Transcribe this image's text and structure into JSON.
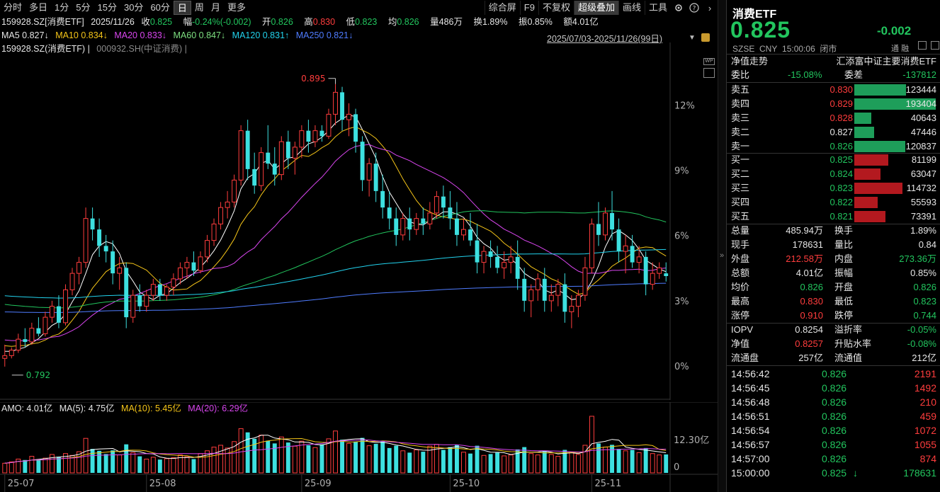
{
  "toolbar": {
    "periods": [
      "分时",
      "多日",
      "1分",
      "5分",
      "15分",
      "30分",
      "60分",
      "日",
      "周",
      "月",
      "更多"
    ],
    "active_period": "日",
    "right_items": [
      "综合屏",
      "F9",
      "不复权",
      "超级叠加",
      "画线",
      "工具"
    ],
    "highlight_item": "超级叠加",
    "icons": [
      "gear-icon",
      "help-icon",
      "chevron-right-icon"
    ]
  },
  "quote_line": {
    "code": "159928.SZ[消费ETF]",
    "date": "2025/11/26",
    "close_label": "收",
    "close": "0.825",
    "change_label": "幅",
    "change": "-0.24%(-0.002)",
    "open_label": "开",
    "open": "0.826",
    "high_label": "高",
    "high": "0.830",
    "low_label": "低",
    "low": "0.823",
    "avg_label": "均",
    "avg": "0.826",
    "vol_label": "量",
    "vol": "486万",
    "turnover_label": "换",
    "turnover": "1.89%",
    "amp_label": "振",
    "amp": "0.85%",
    "amount_label": "额",
    "amount": "4.01亿"
  },
  "ma_line": {
    "ma5": "MA5 0.827↓",
    "ma10": "MA10 0.834↓",
    "ma20": "MA20 0.833↓",
    "ma60": "MA60 0.847↓",
    "ma120": "MA120 0.831↑",
    "ma250": "MA250 0.821↓",
    "date_range": "2025/07/03-2025/11/26(99日)"
  },
  "overlay_line": {
    "main": "159928.SZ(消费ETF) |",
    "overlay": "000932.SH(中证消费) |"
  },
  "chart": {
    "high_marker": "0.895",
    "low_marker": "0.792",
    "pct_ticks": [
      "12%",
      "9%",
      "6%",
      "3%",
      "0%"
    ],
    "x_ticks": [
      "25-07",
      "25-08",
      "25-09",
      "25-10",
      "25-11"
    ]
  },
  "volume": {
    "label": "AMO: 4.01亿",
    "ma5": "MA(5): 4.75亿",
    "ma10": "MA(10): 5.45亿",
    "ma20": "MA(20): 6.29亿",
    "ticks": [
      "12.30亿",
      "0"
    ]
  },
  "panel": {
    "title": "消费ETF",
    "price": "0.825",
    "change": "-0.002",
    "exchange": "SZSE",
    "currency": "CNY",
    "time": "15:00:06",
    "status": "闭市",
    "tag1": "通",
    "tag2": "融",
    "nav_trend": "净值走势",
    "fund_name": "汇添富中证主要消费ETF",
    "wb_label": "委比",
    "wb": "-15.08%",
    "wc_label": "委差",
    "wc": "-137812",
    "asks": [
      {
        "label": "卖五",
        "price": "0.830",
        "vol": "123444",
        "color": "red"
      },
      {
        "label": "卖四",
        "price": "0.829",
        "vol": "193404",
        "color": "red"
      },
      {
        "label": "卖三",
        "price": "0.828",
        "vol": "40643",
        "color": "red"
      },
      {
        "label": "卖二",
        "price": "0.827",
        "vol": "47446",
        "color": "white"
      },
      {
        "label": "卖一",
        "price": "0.826",
        "vol": "120837",
        "color": "green"
      }
    ],
    "bids": [
      {
        "label": "买一",
        "price": "0.825",
        "vol": "81199",
        "color": "green"
      },
      {
        "label": "买二",
        "price": "0.824",
        "vol": "63047",
        "color": "green"
      },
      {
        "label": "买三",
        "price": "0.823",
        "vol": "114732",
        "color": "green"
      },
      {
        "label": "买四",
        "price": "0.822",
        "vol": "55593",
        "color": "green"
      },
      {
        "label": "买五",
        "price": "0.821",
        "vol": "73391",
        "color": "green"
      }
    ],
    "stats": [
      [
        {
          "l": "总量",
          "v": "485.94万",
          "c": "white"
        },
        {
          "l": "换手",
          "v": "1.89%",
          "c": "white"
        }
      ],
      [
        {
          "l": "现手",
          "v": "178631",
          "c": "white"
        },
        {
          "l": "量比",
          "v": "0.84",
          "c": "white"
        }
      ],
      [
        {
          "l": "外盘",
          "v": "212.58万",
          "c": "red"
        },
        {
          "l": "内盘",
          "v": "273.36万",
          "c": "green"
        }
      ],
      [
        {
          "l": "总额",
          "v": "4.01亿",
          "c": "white"
        },
        {
          "l": "振幅",
          "v": "0.85%",
          "c": "white"
        }
      ],
      [
        {
          "l": "均价",
          "v": "0.826",
          "c": "green"
        },
        {
          "l": "开盘",
          "v": "0.826",
          "c": "green"
        }
      ],
      [
        {
          "l": "最高",
          "v": "0.830",
          "c": "red"
        },
        {
          "l": "最低",
          "v": "0.823",
          "c": "green"
        }
      ],
      [
        {
          "l": "涨停",
          "v": "0.910",
          "c": "red"
        },
        {
          "l": "跌停",
          "v": "0.744",
          "c": "green"
        }
      ]
    ],
    "stats2": [
      [
        {
          "l": "IOPV",
          "v": "0.8254",
          "c": "white"
        },
        {
          "l": "溢折率",
          "v": "-0.05%",
          "c": "green"
        }
      ],
      [
        {
          "l": "净值",
          "v": "0.8257",
          "c": "red"
        },
        {
          "l": "升贴水率",
          "v": "-0.08%",
          "c": "green"
        }
      ],
      [
        {
          "l": "流通盘",
          "v": "257亿",
          "c": "white"
        },
        {
          "l": "流通值",
          "v": "212亿",
          "c": "white"
        }
      ]
    ],
    "ticks": [
      {
        "t": "14:56:42",
        "p": "0.826",
        "v": "2191"
      },
      {
        "t": "14:56:45",
        "p": "0.826",
        "v": "1492"
      },
      {
        "t": "14:56:48",
        "p": "0.826",
        "v": "210"
      },
      {
        "t": "14:56:51",
        "p": "0.826",
        "v": "459"
      },
      {
        "t": "14:56:54",
        "p": "0.826",
        "v": "1072"
      },
      {
        "t": "14:56:57",
        "p": "0.826",
        "v": "1055"
      },
      {
        "t": "14:57:00",
        "p": "0.826",
        "v": "874"
      },
      {
        "t": "15:00:00",
        "p": "0.825",
        "v": "178631",
        "down": true
      }
    ]
  },
  "colors": {
    "up": "#ff3d3d",
    "down": "#3de0e0",
    "ma5": "#ffffff",
    "ma10": "#f5c518",
    "ma20": "#d946ef",
    "ma60": "#22c55e",
    "ma120": "#22d3ee",
    "ma250": "#4f7cff"
  },
  "chart_data": {
    "type": "candlestick",
    "title": "159928.SZ[消费ETF]",
    "y_unit": "price",
    "high": 0.895,
    "low": 0.792,
    "ohlc": [
      [
        0.795,
        0.8,
        0.792,
        0.796
      ],
      [
        0.796,
        0.799,
        0.795,
        0.798
      ],
      [
        0.798,
        0.804,
        0.797,
        0.802
      ],
      [
        0.802,
        0.806,
        0.799,
        0.801
      ],
      [
        0.801,
        0.808,
        0.8,
        0.806
      ],
      [
        0.806,
        0.81,
        0.803,
        0.804
      ],
      [
        0.804,
        0.812,
        0.803,
        0.81
      ],
      [
        0.81,
        0.816,
        0.808,
        0.814
      ],
      [
        0.814,
        0.818,
        0.806,
        0.808
      ],
      [
        0.808,
        0.822,
        0.807,
        0.82
      ],
      [
        0.82,
        0.828,
        0.818,
        0.826
      ],
      [
        0.826,
        0.832,
        0.822,
        0.83
      ],
      [
        0.83,
        0.85,
        0.828,
        0.846
      ],
      [
        0.846,
        0.85,
        0.838,
        0.842
      ],
      [
        0.842,
        0.846,
        0.832,
        0.836
      ],
      [
        0.836,
        0.84,
        0.83,
        0.834
      ],
      [
        0.834,
        0.838,
        0.822,
        0.826
      ],
      [
        0.826,
        0.832,
        0.82,
        0.828
      ],
      [
        0.828,
        0.83,
        0.806,
        0.81
      ],
      [
        0.81,
        0.82,
        0.808,
        0.818
      ],
      [
        0.818,
        0.822,
        0.812,
        0.814
      ],
      [
        0.814,
        0.82,
        0.812,
        0.818
      ],
      [
        0.818,
        0.824,
        0.816,
        0.822
      ],
      [
        0.822,
        0.824,
        0.816,
        0.818
      ],
      [
        0.818,
        0.822,
        0.816,
        0.821
      ],
      [
        0.821,
        0.826,
        0.818,
        0.824
      ],
      [
        0.824,
        0.83,
        0.822,
        0.828
      ],
      [
        0.828,
        0.832,
        0.824,
        0.83
      ],
      [
        0.83,
        0.834,
        0.825,
        0.827
      ],
      [
        0.827,
        0.834,
        0.826,
        0.832
      ],
      [
        0.832,
        0.84,
        0.83,
        0.838
      ],
      [
        0.838,
        0.846,
        0.836,
        0.844
      ],
      [
        0.844,
        0.852,
        0.842,
        0.85
      ],
      [
        0.85,
        0.856,
        0.846,
        0.852
      ],
      [
        0.852,
        0.862,
        0.85,
        0.86
      ],
      [
        0.86,
        0.88,
        0.858,
        0.878
      ],
      [
        0.878,
        0.882,
        0.86,
        0.864
      ],
      [
        0.864,
        0.87,
        0.855,
        0.858
      ],
      [
        0.858,
        0.872,
        0.856,
        0.87
      ],
      [
        0.87,
        0.88,
        0.864,
        0.866
      ],
      [
        0.866,
        0.872,
        0.858,
        0.862
      ],
      [
        0.862,
        0.876,
        0.86,
        0.874
      ],
      [
        0.874,
        0.878,
        0.864,
        0.868
      ],
      [
        0.868,
        0.874,
        0.862,
        0.872
      ],
      [
        0.872,
        0.88,
        0.868,
        0.878
      ],
      [
        0.878,
        0.882,
        0.87,
        0.874
      ],
      [
        0.874,
        0.88,
        0.872,
        0.878
      ],
      [
        0.878,
        0.88,
        0.874,
        0.876
      ],
      [
        0.876,
        0.886,
        0.875,
        0.884
      ],
      [
        0.884,
        0.895,
        0.88,
        0.892
      ],
      [
        0.892,
        0.894,
        0.878,
        0.882
      ],
      [
        0.882,
        0.888,
        0.876,
        0.884
      ],
      [
        0.884,
        0.886,
        0.87,
        0.874
      ],
      [
        0.874,
        0.876,
        0.856,
        0.86
      ],
      [
        0.86,
        0.868,
        0.854,
        0.866
      ],
      [
        0.866,
        0.87,
        0.852,
        0.856
      ],
      [
        0.856,
        0.862,
        0.846,
        0.85
      ],
      [
        0.85,
        0.856,
        0.842,
        0.846
      ],
      [
        0.846,
        0.85,
        0.836,
        0.84
      ],
      [
        0.84,
        0.848,
        0.838,
        0.846
      ],
      [
        0.846,
        0.85,
        0.838,
        0.842
      ],
      [
        0.842,
        0.848,
        0.84,
        0.846
      ],
      [
        0.846,
        0.85,
        0.84,
        0.844
      ],
      [
        0.844,
        0.852,
        0.842,
        0.848
      ],
      [
        0.848,
        0.856,
        0.846,
        0.854
      ],
      [
        0.854,
        0.858,
        0.846,
        0.85
      ],
      [
        0.85,
        0.856,
        0.842,
        0.846
      ],
      [
        0.846,
        0.852,
        0.836,
        0.84
      ],
      [
        0.84,
        0.846,
        0.838,
        0.842
      ],
      [
        0.842,
        0.848,
        0.836,
        0.838
      ],
      [
        0.838,
        0.844,
        0.826,
        0.83
      ],
      [
        0.83,
        0.836,
        0.826,
        0.834
      ],
      [
        0.834,
        0.838,
        0.828,
        0.832
      ],
      [
        0.832,
        0.836,
        0.826,
        0.828
      ],
      [
        0.828,
        0.834,
        0.824,
        0.83
      ],
      [
        0.83,
        0.836,
        0.826,
        0.832
      ],
      [
        0.832,
        0.838,
        0.82,
        0.824
      ],
      [
        0.824,
        0.828,
        0.812,
        0.816
      ],
      [
        0.816,
        0.822,
        0.81,
        0.82
      ],
      [
        0.82,
        0.826,
        0.816,
        0.824
      ],
      [
        0.824,
        0.828,
        0.812,
        0.816
      ],
      [
        0.816,
        0.822,
        0.812,
        0.818
      ],
      [
        0.818,
        0.824,
        0.814,
        0.822
      ],
      [
        0.822,
        0.826,
        0.808,
        0.812
      ],
      [
        0.812,
        0.818,
        0.806,
        0.814
      ],
      [
        0.814,
        0.82,
        0.81,
        0.818
      ],
      [
        0.818,
        0.832,
        0.816,
        0.828
      ],
      [
        0.828,
        0.846,
        0.826,
        0.844
      ],
      [
        0.844,
        0.852,
        0.836,
        0.84
      ],
      [
        0.84,
        0.85,
        0.838,
        0.848
      ],
      [
        0.848,
        0.856,
        0.838,
        0.842
      ],
      [
        0.842,
        0.846,
        0.83,
        0.834
      ],
      [
        0.834,
        0.84,
        0.826,
        0.836
      ],
      [
        0.836,
        0.84,
        0.828,
        0.83
      ],
      [
        0.83,
        0.836,
        0.826,
        0.832
      ],
      [
        0.832,
        0.834,
        0.818,
        0.822
      ],
      [
        0.822,
        0.83,
        0.82,
        0.826
      ],
      [
        0.826,
        0.83,
        0.824,
        0.828
      ],
      [
        0.826,
        0.83,
        0.823,
        0.825
      ]
    ],
    "volume": [
      2.1,
      2.4,
      3.0,
      2.8,
      3.6,
      2.9,
      3.2,
      4.0,
      3.5,
      4.2,
      3.8,
      4.6,
      7.5,
      5.2,
      4.8,
      4.1,
      4.9,
      3.9,
      6.2,
      4.4,
      3.6,
      3.0,
      3.4,
      2.9,
      3.1,
      3.3,
      3.9,
      3.5,
      3.0,
      4.2,
      4.8,
      5.6,
      6.0,
      5.4,
      6.8,
      9.6,
      8.8,
      7.4,
      8.2,
      7.0,
      6.4,
      7.8,
      6.6,
      5.8,
      6.9,
      6.0,
      5.5,
      6.2,
      7.4,
      9.1,
      7.2,
      6.4,
      6.8,
      7.6,
      5.9,
      6.3,
      6.8,
      5.4,
      5.9,
      4.8,
      4.4,
      5.0,
      4.6,
      5.8,
      6.2,
      5.0,
      5.6,
      6.1,
      4.5,
      4.2,
      5.9,
      3.8,
      4.1,
      4.4,
      3.7,
      3.9,
      5.1,
      5.6,
      4.2,
      3.9,
      4.8,
      4.0,
      3.6,
      5.0,
      4.4,
      4.0,
      6.0,
      12.3,
      6.4,
      5.6,
      6.1,
      5.2,
      4.8,
      5.0,
      4.4,
      5.4,
      4.2,
      3.9,
      4.01
    ],
    "volume_unit": "亿",
    "ylim_pct": [
      0,
      12
    ],
    "x_ticks": [
      "25-07",
      "25-08",
      "25-09",
      "25-10",
      "25-11"
    ]
  }
}
